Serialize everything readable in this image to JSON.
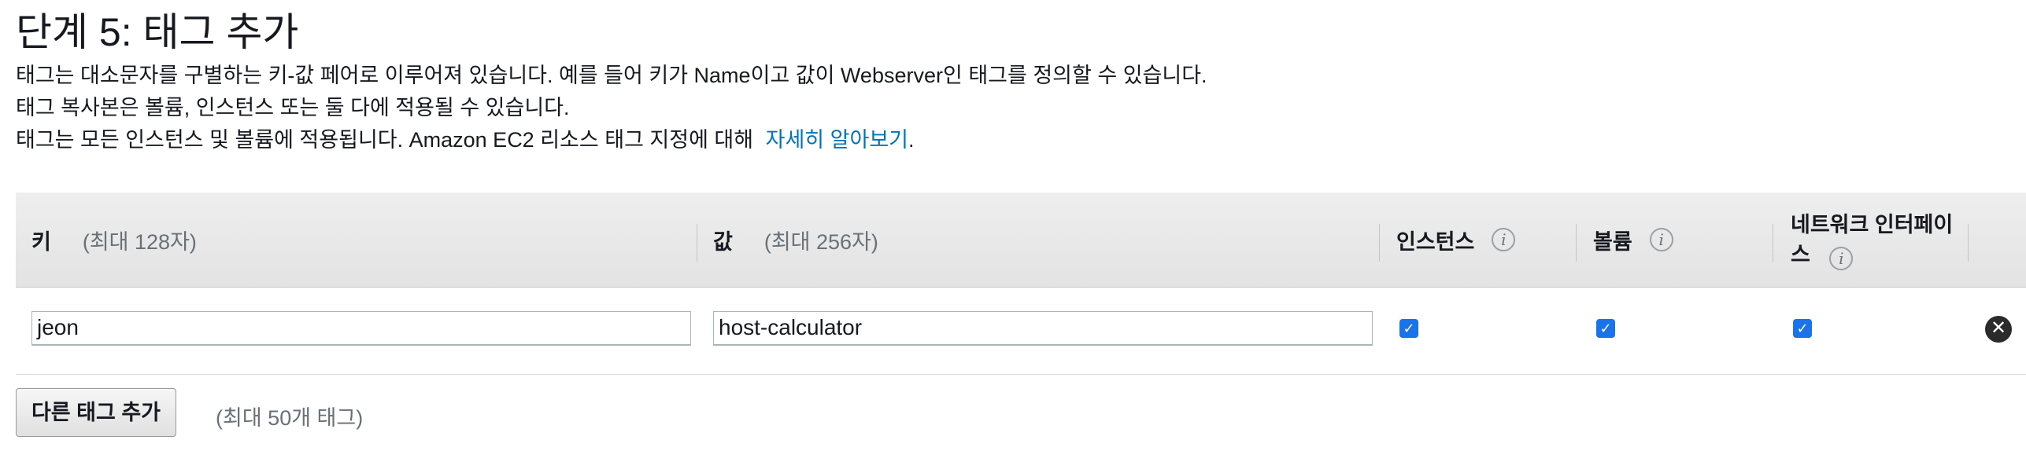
{
  "page": {
    "title": "단계 5: 태그 추가",
    "description_lines": [
      "태그는 대소문자를 구별하는 키-값 페어로 이루어져 있습니다. 예를 들어 키가 Name이고 값이 Webserver인 태그를 정의할 수 있습니다.",
      "태그 복사본은 볼륨, 인스턴스 또는 둘 다에 적용될 수 있습니다."
    ],
    "line3_text": "태그는 모든 인스턴스 및 볼륨에 적용됩니다. Amazon EC2 리소스 태그 지정에 대해",
    "line3_link": "자세히 알아보기",
    "line3_period": "."
  },
  "table": {
    "headers": {
      "key_label": "키",
      "key_hint": "(최대 128자)",
      "value_label": "값",
      "value_hint": "(최대 256자)",
      "instances_label": "인스턴스",
      "volumes_label": "볼륨",
      "network_line1": "네트워크 인터페이",
      "network_line2": "스"
    },
    "rows": [
      {
        "key": "jeon",
        "value": "host-calculator",
        "instances_checked": true,
        "volumes_checked": true,
        "network_checked": true
      }
    ]
  },
  "footer": {
    "add_button_label": "다른 태그 추가",
    "limit_text": "(최대 50개 태그)"
  },
  "colors": {
    "link": "#0073bb",
    "checkbox": "#1a73e8"
  },
  "icons": {
    "info": "info-icon",
    "check": "checkmark-icon",
    "remove": "close-circle-icon"
  }
}
